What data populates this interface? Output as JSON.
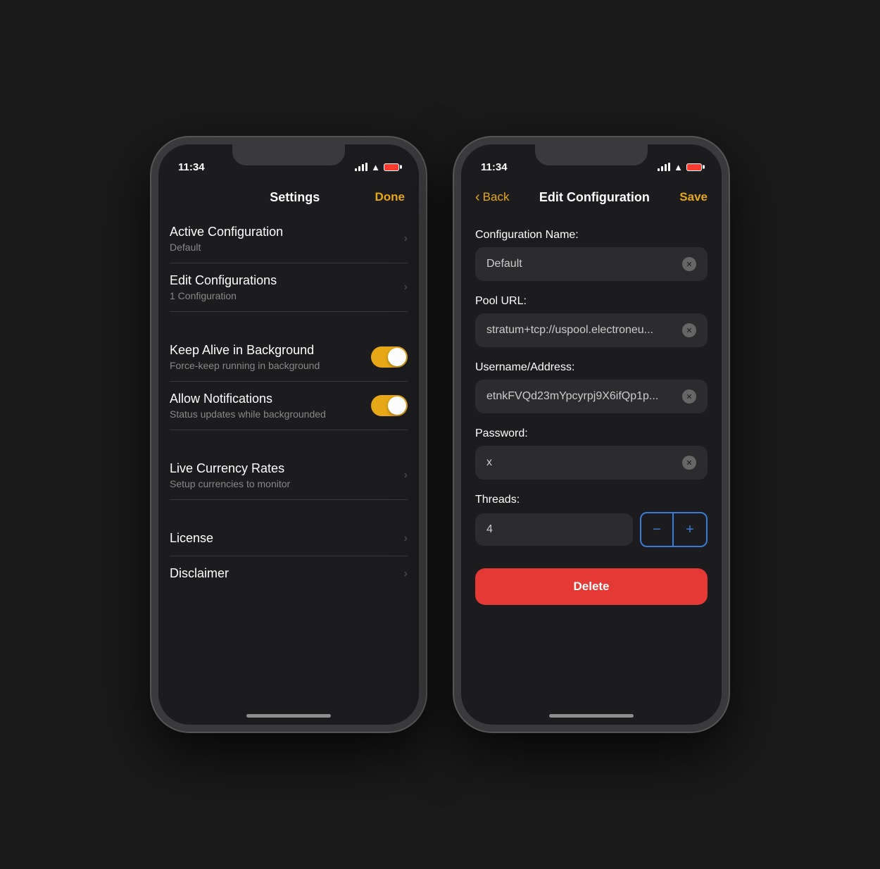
{
  "left_phone": {
    "time": "11:34",
    "nav": {
      "title": "Settings",
      "done_label": "Done"
    },
    "items": [
      {
        "title": "Active Configuration",
        "subtitle": "Default",
        "has_chevron": true,
        "has_toggle": false
      },
      {
        "title": "Edit Configurations",
        "subtitle": "1 Configuration",
        "has_chevron": true,
        "has_toggle": false
      }
    ],
    "toggle_items": [
      {
        "title": "Keep Alive in Background",
        "subtitle": "Force-keep running in background",
        "has_chevron": false,
        "has_toggle": true
      },
      {
        "title": "Allow Notifications",
        "subtitle": "Status updates while backgrounded",
        "has_chevron": false,
        "has_toggle": true
      }
    ],
    "bottom_items": [
      {
        "title": "Live Currency Rates",
        "subtitle": "Setup currencies to monitor",
        "has_chevron": true
      },
      {
        "title": "License",
        "subtitle": "",
        "has_chevron": true
      },
      {
        "title": "Disclaimer",
        "subtitle": "",
        "has_chevron": true
      }
    ]
  },
  "right_phone": {
    "time": "11:34",
    "nav": {
      "back_label": "Back",
      "title": "Edit Configuration",
      "save_label": "Save"
    },
    "fields": [
      {
        "label": "Configuration Name:",
        "value": "Default",
        "has_clear": true
      },
      {
        "label": "Pool URL:",
        "value": "stratum+tcp://uspool.electroneu...",
        "has_clear": true
      },
      {
        "label": "Username/Address:",
        "value": "etnkFVQd23mYpcyrpj9X6ifQp1p...",
        "has_clear": true
      },
      {
        "label": "Password:",
        "value": "x",
        "has_clear": true
      }
    ],
    "threads": {
      "label": "Threads:",
      "value": "4",
      "minus_label": "−",
      "plus_label": "+"
    },
    "delete_label": "Delete"
  }
}
